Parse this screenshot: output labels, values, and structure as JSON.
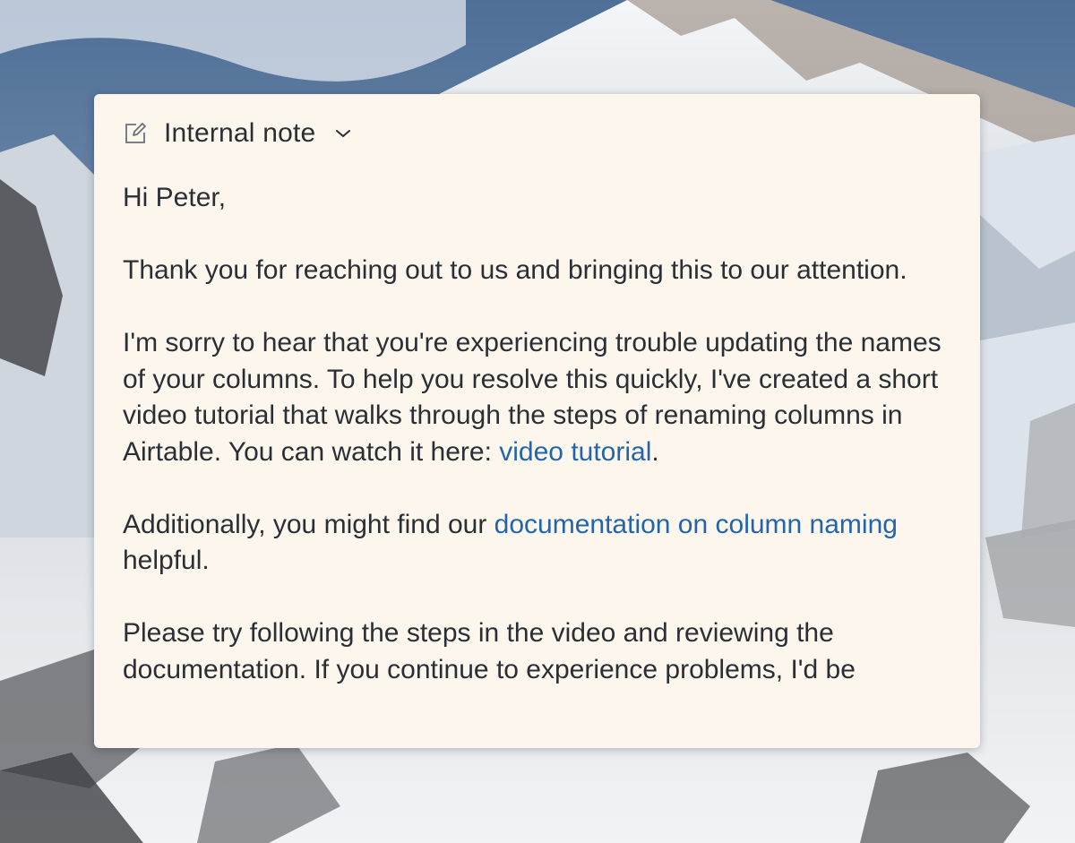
{
  "note": {
    "type_label": "Internal note",
    "type_icon": "note-edit-icon",
    "dropdown_icon": "chevron-down-icon",
    "greeting": "Hi Peter,",
    "paragraph1": "Thank you for reaching out to us and bringing this to our attention.",
    "paragraph2": {
      "text_before": "I'm sorry to hear that you're experiencing trouble updating the names of your columns. To help you resolve this quickly, I've created a short video tutorial that walks through the steps of renaming columns in Airtable. You can watch it here: ",
      "link": "video tutorial",
      "text_after": "."
    },
    "paragraph3": {
      "text_before": "Additionally, you might find our ",
      "link": "documentation on column naming",
      "text_after": " helpful."
    },
    "paragraph4": "Please try following the steps in the video and reviewing the documentation. If you continue to experience problems, I'd be"
  },
  "colors": {
    "card_background": "#fdf6ed",
    "text": "#2a2f36",
    "link": "#2166ac"
  }
}
